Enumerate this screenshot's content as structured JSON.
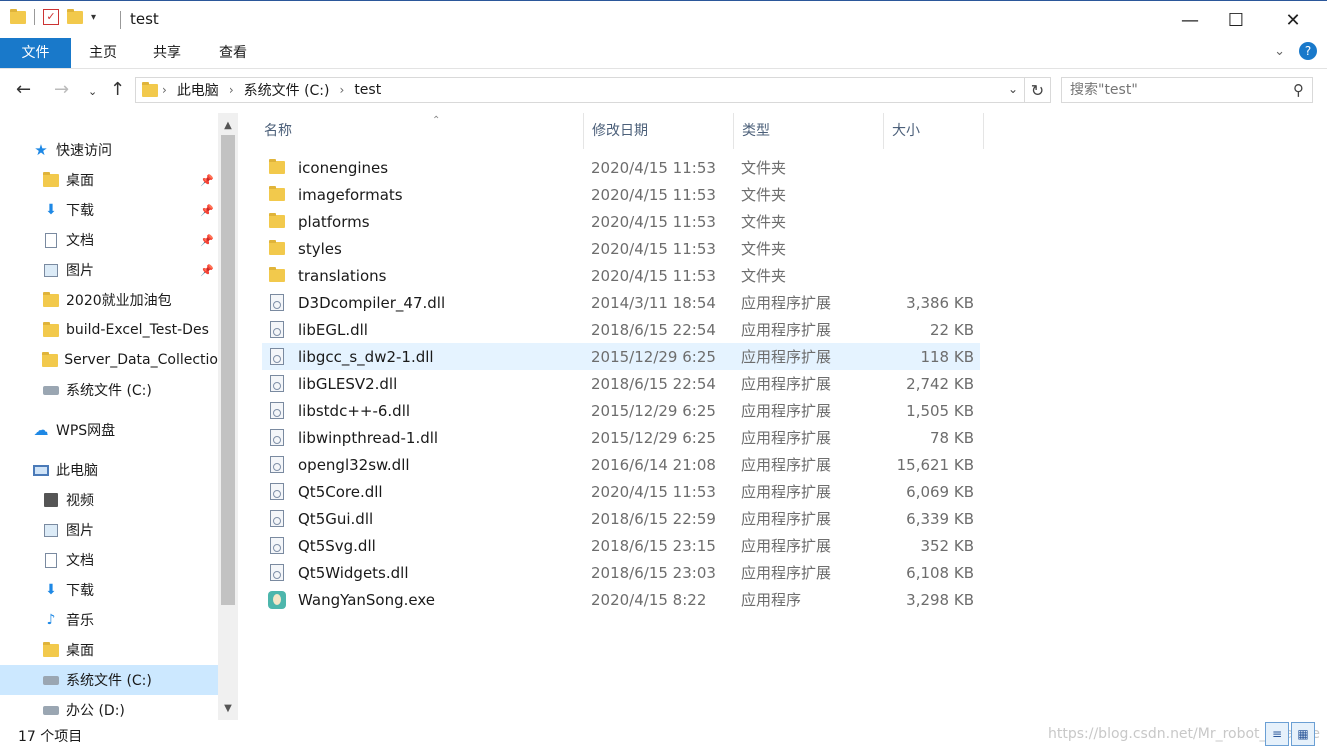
{
  "window": {
    "title": "test",
    "minimize_glyph": "—",
    "maximize_glyph": "☐",
    "close_glyph": "✕"
  },
  "ribbon": {
    "tabs": [
      {
        "label": "文件"
      },
      {
        "label": "主页"
      },
      {
        "label": "共享"
      },
      {
        "label": "查看"
      }
    ]
  },
  "address": {
    "crumbs": [
      "此电脑",
      "系统文件 (C:)",
      "test"
    ]
  },
  "search": {
    "placeholder": "搜索\"test\""
  },
  "sidebar": {
    "items": [
      {
        "label": "快速访问",
        "icon": "star-icon",
        "level": 0,
        "pinned": false
      },
      {
        "label": "桌面",
        "icon": "folder-icon",
        "level": 1,
        "pinned": true
      },
      {
        "label": "下载",
        "icon": "download-icon",
        "level": 1,
        "pinned": true
      },
      {
        "label": "文档",
        "icon": "document-icon",
        "level": 1,
        "pinned": true
      },
      {
        "label": "图片",
        "icon": "picture-icon",
        "level": 1,
        "pinned": true
      },
      {
        "label": "2020就业加油包",
        "icon": "folder-icon",
        "level": 1,
        "pinned": false
      },
      {
        "label": "build-Excel_Test-Des",
        "icon": "folder-icon",
        "level": 1,
        "pinned": false
      },
      {
        "label": "Server_Data_Collectio",
        "icon": "folder-icon",
        "level": 1,
        "pinned": false
      },
      {
        "label": "系统文件 (C:)",
        "icon": "drive-icon",
        "level": 1,
        "pinned": false
      },
      {
        "label": "WPS网盘",
        "icon": "cloud-icon",
        "level": 0,
        "pinned": false
      },
      {
        "label": "此电脑",
        "icon": "computer-icon",
        "level": 0,
        "pinned": false
      },
      {
        "label": "视频",
        "icon": "video-icon",
        "level": 1,
        "pinned": false
      },
      {
        "label": "图片",
        "icon": "picture-icon",
        "level": 1,
        "pinned": false
      },
      {
        "label": "文档",
        "icon": "document-icon",
        "level": 1,
        "pinned": false
      },
      {
        "label": "下载",
        "icon": "download-icon",
        "level": 1,
        "pinned": false
      },
      {
        "label": "音乐",
        "icon": "music-icon",
        "level": 1,
        "pinned": false
      },
      {
        "label": "桌面",
        "icon": "folder-icon",
        "level": 1,
        "pinned": false
      },
      {
        "label": "系统文件 (C:)",
        "icon": "drive-icon",
        "level": 1,
        "pinned": false,
        "selected": true
      },
      {
        "label": "办公 (D:)",
        "icon": "drive-icon",
        "level": 1,
        "pinned": false
      }
    ]
  },
  "columns": {
    "name": "名称",
    "date": "修改日期",
    "type": "类型",
    "size": "大小"
  },
  "files": [
    {
      "name": "iconengines",
      "date": "2020/4/15 11:53",
      "type": "文件夹",
      "size": "",
      "kind": "folder"
    },
    {
      "name": "imageformats",
      "date": "2020/4/15 11:53",
      "type": "文件夹",
      "size": "",
      "kind": "folder"
    },
    {
      "name": "platforms",
      "date": "2020/4/15 11:53",
      "type": "文件夹",
      "size": "",
      "kind": "folder"
    },
    {
      "name": "styles",
      "date": "2020/4/15 11:53",
      "type": "文件夹",
      "size": "",
      "kind": "folder"
    },
    {
      "name": "translations",
      "date": "2020/4/15 11:53",
      "type": "文件夹",
      "size": "",
      "kind": "folder"
    },
    {
      "name": "D3Dcompiler_47.dll",
      "date": "2014/3/11 18:54",
      "type": "应用程序扩展",
      "size": "3,386 KB",
      "kind": "dll"
    },
    {
      "name": "libEGL.dll",
      "date": "2018/6/15 22:54",
      "type": "应用程序扩展",
      "size": "22 KB",
      "kind": "dll"
    },
    {
      "name": "libgcc_s_dw2-1.dll",
      "date": "2015/12/29 6:25",
      "type": "应用程序扩展",
      "size": "118 KB",
      "kind": "dll",
      "hover": true
    },
    {
      "name": "libGLESV2.dll",
      "date": "2018/6/15 22:54",
      "type": "应用程序扩展",
      "size": "2,742 KB",
      "kind": "dll"
    },
    {
      "name": "libstdc++-6.dll",
      "date": "2015/12/29 6:25",
      "type": "应用程序扩展",
      "size": "1,505 KB",
      "kind": "dll"
    },
    {
      "name": "libwinpthread-1.dll",
      "date": "2015/12/29 6:25",
      "type": "应用程序扩展",
      "size": "78 KB",
      "kind": "dll"
    },
    {
      "name": "opengl32sw.dll",
      "date": "2016/6/14 21:08",
      "type": "应用程序扩展",
      "size": "15,621 KB",
      "kind": "dll"
    },
    {
      "name": "Qt5Core.dll",
      "date": "2020/4/15 11:53",
      "type": "应用程序扩展",
      "size": "6,069 KB",
      "kind": "dll"
    },
    {
      "name": "Qt5Gui.dll",
      "date": "2018/6/15 22:59",
      "type": "应用程序扩展",
      "size": "6,339 KB",
      "kind": "dll"
    },
    {
      "name": "Qt5Svg.dll",
      "date": "2018/6/15 23:15",
      "type": "应用程序扩展",
      "size": "352 KB",
      "kind": "dll"
    },
    {
      "name": "Qt5Widgets.dll",
      "date": "2018/6/15 23:03",
      "type": "应用程序扩展",
      "size": "6,108 KB",
      "kind": "dll"
    },
    {
      "name": "WangYanSong.exe",
      "date": "2020/4/15 8:22",
      "type": "应用程序",
      "size": "3,298 KB",
      "kind": "exe"
    }
  ],
  "status": {
    "item_count": "17 个项目",
    "watermark": "https://blog.csdn.net/Mr_robot_strange"
  }
}
